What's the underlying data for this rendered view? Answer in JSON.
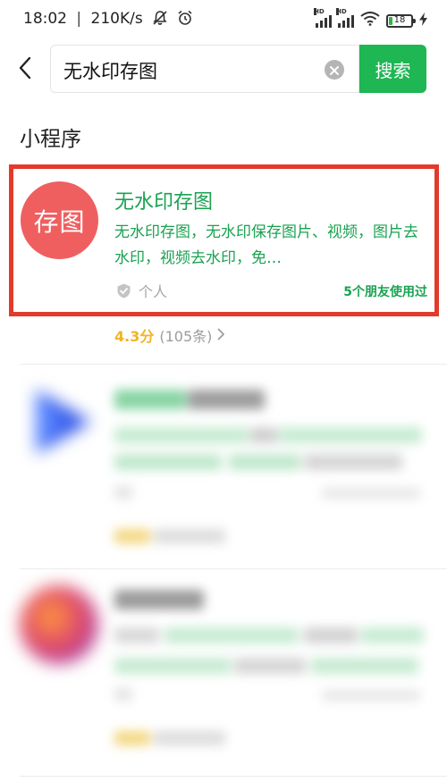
{
  "status_bar": {
    "time": "18:02",
    "speed": "210K/s",
    "network": [
      "HD",
      "HD"
    ],
    "battery": "18",
    "battery_level": 0.18,
    "icons": [
      "mute-icon",
      "alarm-icon",
      "signal-icon",
      "wifi-icon",
      "battery-icon",
      "charging-icon"
    ]
  },
  "search": {
    "query": "无水印存图",
    "button_label": "搜索"
  },
  "section": {
    "title": "小程序"
  },
  "results": [
    {
      "icon_text": "存图",
      "icon_color": "#ef5f60",
      "title": "无水印存图",
      "description": "无水印存图，无水印保存图片、视频，图片去水印，视频去水印，免…",
      "developer": "个人",
      "friends": "5个朋友使用过",
      "rating_score": "4.3分",
      "rating_count": "(105条)"
    }
  ],
  "colors": {
    "accent": "#1fb654",
    "title_green": "#1aa251",
    "highlight_red": "#e33a2b",
    "rating_yellow": "#f0b426"
  }
}
